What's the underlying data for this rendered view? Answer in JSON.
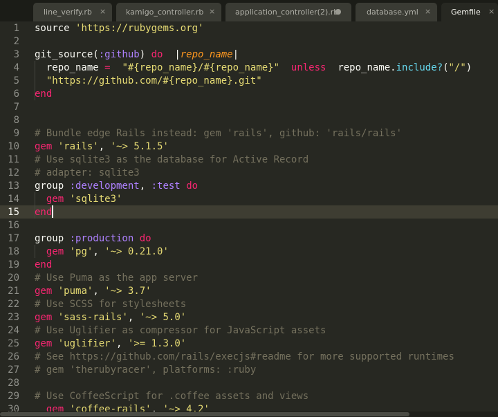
{
  "tabs": [
    {
      "label": "line_verify.rb",
      "control": "×",
      "active": false
    },
    {
      "label": "kamigo_controller.rb",
      "control": "×",
      "active": false
    },
    {
      "label": "application_controller(2).rb",
      "control": "●",
      "active": false
    },
    {
      "label": "database.yml",
      "control": "×",
      "active": false
    },
    {
      "label": "Gemfile",
      "control": "×",
      "active": true
    }
  ],
  "editor": {
    "line_numbers": [
      "1",
      "2",
      "3",
      "4",
      "5",
      "6",
      "7",
      "8",
      "9",
      "10",
      "11",
      "12",
      "13",
      "14",
      "15",
      "16",
      "17",
      "18",
      "19",
      "20",
      "21",
      "22",
      "23",
      "24",
      "25",
      "26",
      "27",
      "28",
      "29",
      "30"
    ],
    "current_line": "15",
    "lines": [
      {
        "n": "1",
        "parts": [
          [
            "",
            "source "
          ],
          [
            "str",
            "'https://rubygems.org'"
          ]
        ]
      },
      {
        "n": "2",
        "parts": []
      },
      {
        "n": "3",
        "parts": [
          [
            "",
            "git_source("
          ],
          [
            "sym",
            ":github"
          ],
          [
            "",
            ") "
          ],
          [
            "kw",
            "do"
          ],
          [
            "",
            "  "
          ],
          [
            "pipe",
            "|"
          ],
          [
            "param",
            "repo_name"
          ],
          [
            "pipe",
            "|"
          ]
        ]
      },
      {
        "n": "4",
        "parts": [
          [
            "",
            "  repo_name "
          ],
          [
            "kw",
            "="
          ],
          [
            "",
            "  "
          ],
          [
            "str",
            "\"#{repo_name}/#{repo_name}\""
          ],
          [
            "",
            "  "
          ],
          [
            "kw",
            "unless"
          ],
          [
            "",
            "  repo_name."
          ],
          [
            "fn",
            "include?"
          ],
          [
            "",
            "("
          ],
          [
            "str",
            "\"/\""
          ],
          [
            "",
            ")"
          ]
        ]
      },
      {
        "n": "5",
        "parts": [
          [
            "",
            "  "
          ],
          [
            "str",
            "\"https://github.com/#{repo_name}.git\""
          ]
        ]
      },
      {
        "n": "6",
        "parts": [
          [
            "kw",
            "end"
          ]
        ]
      },
      {
        "n": "7",
        "parts": []
      },
      {
        "n": "8",
        "parts": []
      },
      {
        "n": "9",
        "parts": [
          [
            "cmt",
            "# Bundle edge Rails instead: gem 'rails', github: 'rails/rails'"
          ]
        ]
      },
      {
        "n": "10",
        "parts": [
          [
            "kw",
            "gem"
          ],
          [
            "",
            " "
          ],
          [
            "str",
            "'rails'"
          ],
          [
            "",
            ", "
          ],
          [
            "str",
            "'~> 5.1.5'"
          ]
        ]
      },
      {
        "n": "11",
        "parts": [
          [
            "cmt",
            "# Use sqlite3 as the database for Active Record"
          ]
        ]
      },
      {
        "n": "12",
        "parts": [
          [
            "cmt",
            "# adapter: sqlite3"
          ]
        ]
      },
      {
        "n": "13",
        "parts": [
          [
            "",
            "group "
          ],
          [
            "sym",
            ":development"
          ],
          [
            "",
            ", "
          ],
          [
            "sym",
            ":test"
          ],
          [
            "",
            " "
          ],
          [
            "kw",
            "do"
          ]
        ]
      },
      {
        "n": "14",
        "parts": [
          [
            "",
            "  "
          ],
          [
            "kw",
            "gem"
          ],
          [
            "",
            " "
          ],
          [
            "str",
            "'sqlite3'"
          ]
        ]
      },
      {
        "n": "15",
        "parts": [
          [
            "kw",
            "end"
          ]
        ]
      },
      {
        "n": "16",
        "parts": []
      },
      {
        "n": "17",
        "parts": [
          [
            "",
            "group "
          ],
          [
            "sym",
            ":production"
          ],
          [
            "",
            " "
          ],
          [
            "kw",
            "do"
          ]
        ]
      },
      {
        "n": "18",
        "parts": [
          [
            "",
            "  "
          ],
          [
            "kw",
            "gem"
          ],
          [
            "",
            " "
          ],
          [
            "str",
            "'pg'"
          ],
          [
            "",
            ", "
          ],
          [
            "str",
            "'~> 0.21.0'"
          ]
        ]
      },
      {
        "n": "19",
        "parts": [
          [
            "kw",
            "end"
          ]
        ]
      },
      {
        "n": "20",
        "parts": [
          [
            "cmt",
            "# Use Puma as the app server"
          ]
        ]
      },
      {
        "n": "21",
        "parts": [
          [
            "kw",
            "gem"
          ],
          [
            "",
            " "
          ],
          [
            "str",
            "'puma'"
          ],
          [
            "",
            ", "
          ],
          [
            "str",
            "'~> 3.7'"
          ]
        ]
      },
      {
        "n": "22",
        "parts": [
          [
            "cmt",
            "# Use SCSS for stylesheets"
          ]
        ]
      },
      {
        "n": "23",
        "parts": [
          [
            "kw",
            "gem"
          ],
          [
            "",
            " "
          ],
          [
            "str",
            "'sass-rails'"
          ],
          [
            "",
            ", "
          ],
          [
            "str",
            "'~> 5.0'"
          ]
        ]
      },
      {
        "n": "24",
        "parts": [
          [
            "cmt",
            "# Use Uglifier as compressor for JavaScript assets"
          ]
        ]
      },
      {
        "n": "25",
        "parts": [
          [
            "kw",
            "gem"
          ],
          [
            "",
            " "
          ],
          [
            "str",
            "'uglifier'"
          ],
          [
            "",
            ", "
          ],
          [
            "str",
            "'>= 1.3.0'"
          ]
        ]
      },
      {
        "n": "26",
        "parts": [
          [
            "cmt",
            "# See https://github.com/rails/execjs#readme for more supported runtimes"
          ]
        ]
      },
      {
        "n": "27",
        "parts": [
          [
            "cmt",
            "# gem 'therubyracer', platforms: :ruby"
          ]
        ]
      },
      {
        "n": "28",
        "parts": []
      },
      {
        "n": "29",
        "parts": [
          [
            "cmt",
            "# Use CoffeeScript for .coffee assets and views"
          ]
        ]
      },
      {
        "n": "30",
        "parts": [
          [
            "",
            "  "
          ],
          [
            "kw",
            "gem"
          ],
          [
            "",
            " "
          ],
          [
            "str",
            "'coffee-rails'"
          ],
          [
            "",
            ", "
          ],
          [
            "str",
            "'~> 4.2'"
          ]
        ]
      }
    ]
  },
  "colors": {
    "background": "#272822",
    "keyword": "#f92672",
    "string": "#e6db74",
    "symbol": "#ae81ff",
    "comment": "#75715e",
    "function": "#66d9ef",
    "parameter": "#fd971f"
  }
}
